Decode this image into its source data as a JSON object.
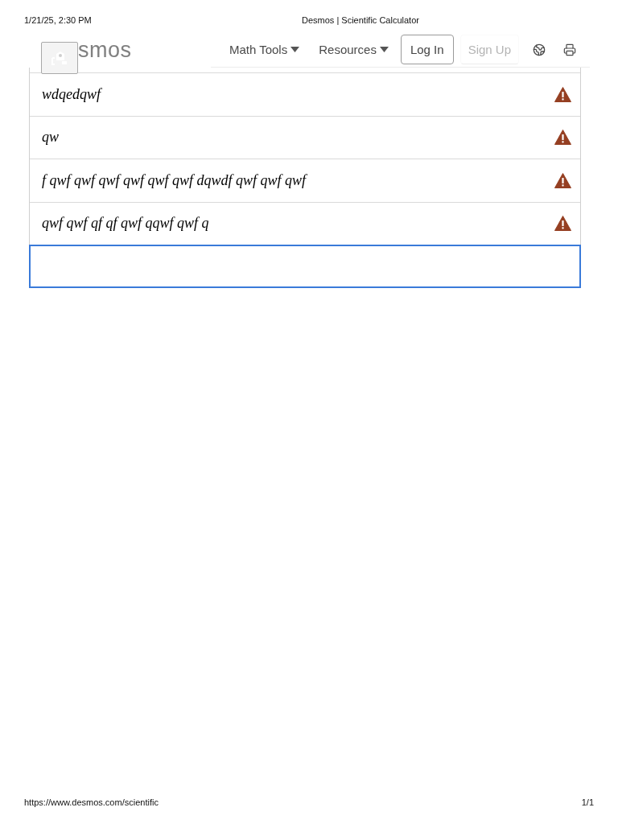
{
  "print_header": {
    "date": "1/21/25, 2:30 PM",
    "title": "Desmos | Scientific Calculator"
  },
  "nav": {
    "logo": "smos",
    "menus": [
      {
        "label": "Math Tools"
      },
      {
        "label": "Resources"
      }
    ],
    "buttons": [
      {
        "label": "Log In",
        "kind": "outlined"
      },
      {
        "label": "Sign Up",
        "kind": "plain"
      }
    ]
  },
  "expressions": [
    {
      "latex": "wdqedqwf",
      "error": true,
      "focused": false
    },
    {
      "latex": "qw",
      "error": true,
      "focused": false
    },
    {
      "latex": "f qwf qwf qwf qwf qwf qwf dqwdf qwf qwf qwf",
      "error": true,
      "focused": false
    },
    {
      "latex": "qwf qwf qf qf qwf qqwf qwf q",
      "error": true,
      "focused": false
    },
    {
      "error": false,
      "focused": true
    }
  ],
  "print_footer": {
    "url": "https://www.desmos.com/scientific",
    "page": "1/1"
  }
}
